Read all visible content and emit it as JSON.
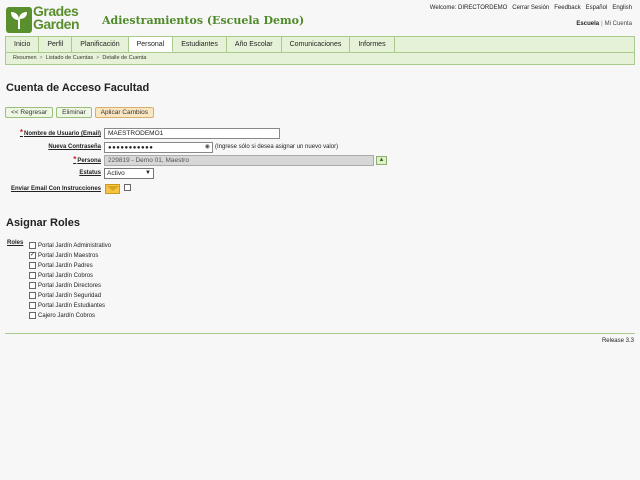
{
  "header": {
    "logo_line1": "Grades",
    "logo_line2": "Garden",
    "app_title": "Adiestramientos (Escuela Demo)",
    "top_links": [
      "Welcome: DIRECTORDEMO",
      "Cerrar Sesión",
      "Feedback",
      "Español",
      "English"
    ],
    "school_label": "Escuela",
    "separator": "|",
    "my_account": "Mi Cuenta"
  },
  "tabs": [
    {
      "label": "Inicio",
      "active": false
    },
    {
      "label": "Perfil",
      "active": false
    },
    {
      "label": "Planificación",
      "active": false
    },
    {
      "label": "Personal",
      "active": true
    },
    {
      "label": "Estudiantes",
      "active": false
    },
    {
      "label": "Año Escolar",
      "active": false
    },
    {
      "label": "Comunicaciones",
      "active": false
    },
    {
      "label": "Informes",
      "active": false
    }
  ],
  "breadcrumb": [
    "Resumen",
    "Listado de Cuentas",
    "Detalle de Cuenta"
  ],
  "breadcrumb_sep": ">",
  "page_title": "Cuenta de Acceso Facultad",
  "buttons": {
    "back": "<< Regresar",
    "delete": "Eliminar",
    "apply": "Aplicar Cambios"
  },
  "form": {
    "username_label": "Nombre de Usuario (Email)",
    "username_value": "MAESTRODEMO1",
    "password_label": "Nueva Contraseña",
    "password_value": "●●●●●●●●●●●",
    "password_hint": "(Ingrese sólo si desea asignar un nuevo valor)",
    "person_label": "Persona",
    "person_value": "229819 - Demo 01, Maestro",
    "status_label": "Estatus",
    "status_value": "Activo",
    "email_label": "Enviar Email Con Instrucciones",
    "required_mark": "*"
  },
  "roles_section": {
    "title": "Asignar Roles",
    "label": "Roles",
    "items": [
      {
        "label": "Portal Jardín Administrativo",
        "checked": false
      },
      {
        "label": "Portal Jardín Maestros",
        "checked": true
      },
      {
        "label": "Portal Jardín Padres",
        "checked": false
      },
      {
        "label": "Portal Jardín Cobros",
        "checked": false
      },
      {
        "label": "Portal Jardín Directores",
        "checked": false
      },
      {
        "label": "Portal Jardín Seguridad",
        "checked": false
      },
      {
        "label": "Portal Jardín Estudiantes",
        "checked": false
      },
      {
        "label": "Cajero Jardín Cobros",
        "checked": false
      }
    ]
  },
  "footer": {
    "release": "Release 3.3"
  },
  "colors": {
    "brand_green": "#5a8f2e",
    "tab_bg": "#e6f2d8",
    "required": "#cc2222"
  }
}
